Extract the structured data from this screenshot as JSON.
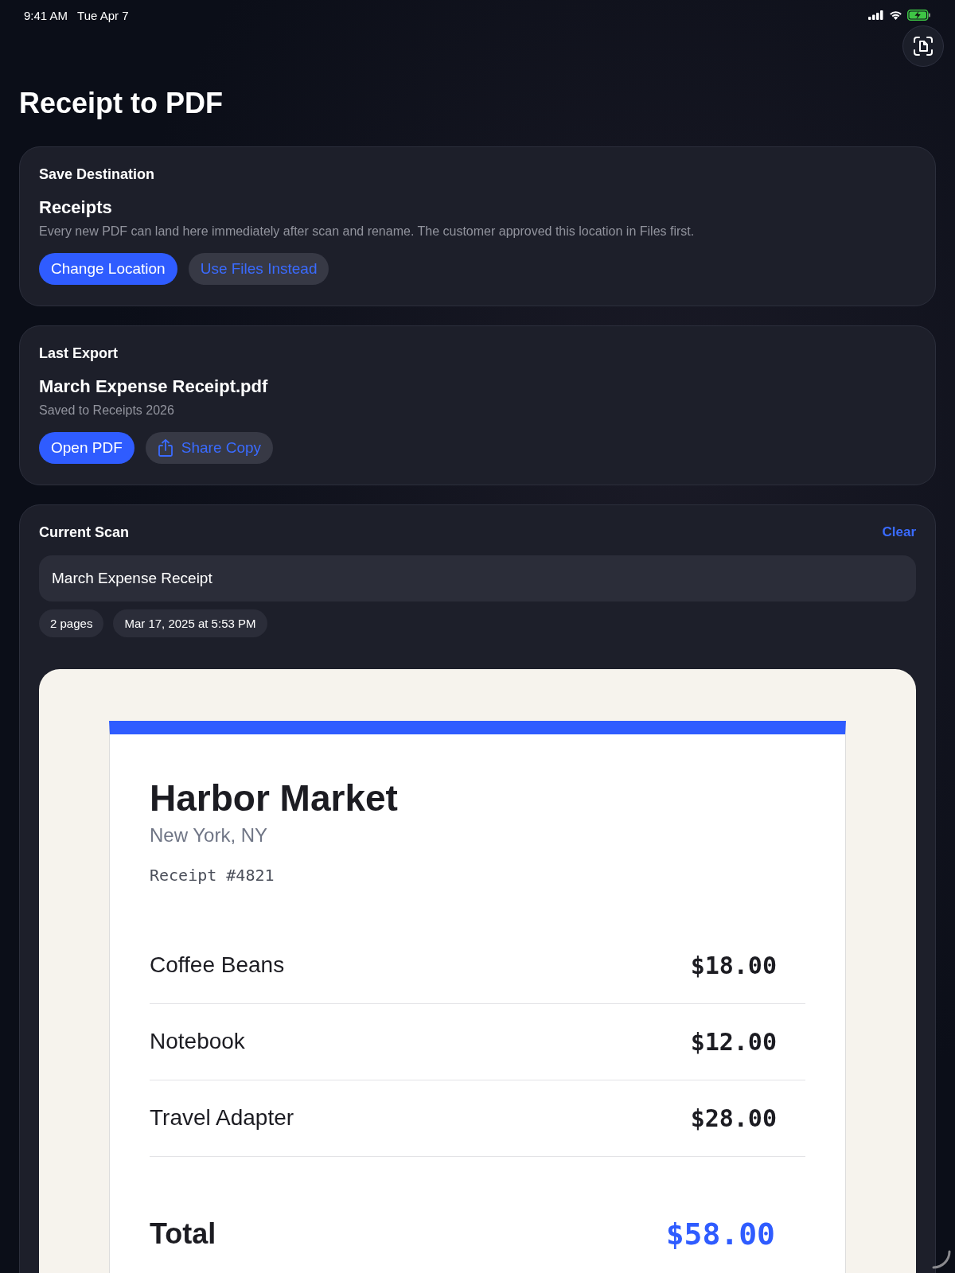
{
  "status_bar": {
    "time": "9:41 AM",
    "date": "Tue Apr 7",
    "battery_charging": true
  },
  "title": "Receipt to PDF",
  "save_destination": {
    "heading": "Save Destination",
    "folder": "Receipts",
    "description": "Every new PDF can land here immediately after scan and rename. The customer approved this location in Files first.",
    "buttons": [
      {
        "label": "Change Location",
        "kind": "primary"
      },
      {
        "label": "Use Files Instead",
        "kind": "secondary"
      }
    ]
  },
  "last_export": {
    "heading": "Last Export",
    "file_name": "March Expense Receipt.pdf",
    "location": "Saved to Receipts 2026",
    "buttons": [
      {
        "label": "Open PDF",
        "kind": "primary"
      },
      {
        "label": "Share Copy",
        "kind": "share"
      }
    ]
  },
  "current_scan": {
    "heading": "Current Scan",
    "clear": "Clear",
    "name_field": {
      "value": "March Expense Receipt"
    },
    "tags": [
      "2 pages",
      "Mar 17, 2025 at 5:53 PM"
    ],
    "receipt": {
      "store": "Harbor Market",
      "city": "New York, NY",
      "number": "Receipt #4821",
      "items": [
        {
          "name": "Coffee Beans",
          "price": "$18.00"
        },
        {
          "name": "Notebook",
          "price": "$12.00"
        },
        {
          "name": "Travel Adapter",
          "price": "$28.00"
        }
      ],
      "total_label": "Total",
      "total": "$58.00"
    }
  }
}
